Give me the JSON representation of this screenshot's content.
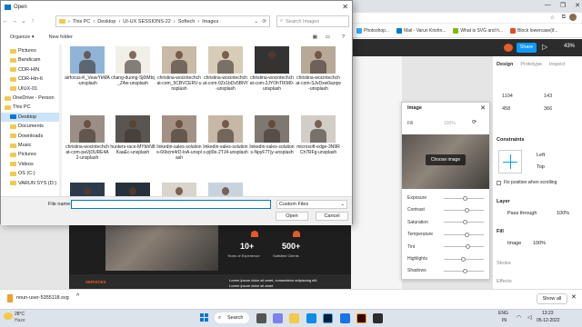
{
  "dialog": {
    "title": "Open",
    "breadcrumb": [
      "This PC",
      "Desktop",
      "UI-UX SESSIONS-22",
      "Softech",
      "Images"
    ],
    "search_placeholder": "Search Images",
    "organize_label": "Organize ▾",
    "new_folder_label": "New folder",
    "file_name_label": "File name:",
    "file_name_value": "",
    "file_type": "Custom Files",
    "open_label": "Open",
    "cancel_label": "Cancel",
    "tree": [
      {
        "label": "Pictures",
        "indent": 1
      },
      {
        "label": "Bandicam",
        "indent": 1
      },
      {
        "label": "CDR-HIN",
        "indent": 1
      },
      {
        "label": "CDR-Hin-6",
        "indent": 1
      },
      {
        "label": "UIUX-01",
        "indent": 1
      },
      {
        "label": "OneDrive - Person",
        "indent": 0
      },
      {
        "label": "This PC",
        "indent": 0
      },
      {
        "label": "Desktop",
        "indent": 1,
        "selected": true
      },
      {
        "label": "Documents",
        "indent": 1
      },
      {
        "label": "Downloads",
        "indent": 1
      },
      {
        "label": "Music",
        "indent": 1
      },
      {
        "label": "Pictures",
        "indent": 1
      },
      {
        "label": "Videos",
        "indent": 1
      },
      {
        "label": "OS (C:)",
        "indent": 1
      },
      {
        "label": "VARUN SYS (D:)",
        "indent": 1
      }
    ],
    "files": [
      {
        "name": "airfocus-K_VeavYkMA-unsplash",
        "color": "#8fb4d8"
      },
      {
        "name": "chang-duong-Sj0iMtq_Z4w-unsplash",
        "color": "#f2efe9"
      },
      {
        "name": "christina-wocintechchat-com_5CBVCERV-unsplash",
        "color": "#c9b9a6"
      },
      {
        "name": "christina-wocintechchat-com-0Zx1bDv5BNY-unsplash",
        "color": "#d8ccb9"
      },
      {
        "name": "christina-wocintechchat-com-2JYOhTIKM0-unsplash",
        "color": "#333333"
      },
      {
        "name": "christina-wocintechchat-com-SJvDxw0azqw-unsplash",
        "color": "#b7a898"
      },
      {
        "name": "christina-wocintechchat-com-paVjDURE4A2-unsplash",
        "color": "#9a8e86"
      },
      {
        "name": "hunters-race-MYbhN8KaaEc-unsplash",
        "color": "#5a5551"
      },
      {
        "name": "linkedin-sales-solutions-66bcm4rD-loA-unsplash",
        "color": "#a39283"
      },
      {
        "name": "linkedin-sales-solutions-pjt0e-2TJ4-unsplash",
        "color": "#c6b7a6"
      },
      {
        "name": "linkedin-sales-solutions-NpyF7Tjy-unsplash",
        "color": "#7e7871"
      },
      {
        "name": "microsoft-edge-3N9RCh7RFg-unsplash",
        "color": "#d2cdc6"
      },
      {
        "name": "",
        "color": "#2d3a4a"
      },
      {
        "name": "",
        "color": "#27313b"
      },
      {
        "name": "",
        "color": "#d9d4cc"
      },
      {
        "name": "",
        "color": "#c8d3de"
      }
    ]
  },
  "browser": {
    "bookmarks": [
      {
        "label": "Photoshop...",
        "color": "#31a8ff"
      },
      {
        "label": "Mail - Varun Krishn...",
        "color": "#0078d4"
      },
      {
        "label": "What is SVG and h...",
        "color": "#7fba00"
      },
      {
        "label": "Block lowercase(if...",
        "color": "#e34c26"
      }
    ],
    "download_file": "noun-user-5355118.svg",
    "show_all": "Show all"
  },
  "figma": {
    "share_label": "Share",
    "zoom": "43%",
    "tabs": [
      "Design",
      "Prototype",
      "Inspect"
    ],
    "x": "1104",
    "y": "143",
    "w": "458",
    "h": "366",
    "constraints_label": "Constraints",
    "left_constraint": "Left",
    "top_constraint": "Top",
    "fix_scroll": "Fix position when scrolling",
    "layer_label": "Layer",
    "pass_through": "Pass through",
    "layer_pct": "100%",
    "fill_label": "Fill",
    "fill_type": "Image",
    "fill_pct": "100%",
    "stroke_label": "Stroke",
    "effects_label": "Effects",
    "image_panel": {
      "title": "Image",
      "fill_mode": "Fill",
      "fill_pct": "100%",
      "choose_image": "Choose image",
      "adjustments": [
        {
          "label": "Exposure",
          "pos": 0.55
        },
        {
          "label": "Contrast",
          "pos": 0.6
        },
        {
          "label": "Saturation",
          "pos": 0.55
        },
        {
          "label": "Temperature",
          "pos": 0.58
        },
        {
          "label": "Tint",
          "pos": 0.62
        },
        {
          "label": "Highlights",
          "pos": 0.5
        },
        {
          "label": "Shadows",
          "pos": 0.55
        }
      ]
    }
  },
  "frame": {
    "stat1_value": "10+",
    "stat1_label": "Years of Experience",
    "stat2_value": "500+",
    "stat2_label": "Satisfied Clients",
    "services": "SERVICES",
    "lorem1": "Lorem ipsum dolor sit amet, consectetur adipiscing elit.",
    "lorem2": "Lorem ipsum dolor sit amet"
  },
  "taskbar": {
    "weather_temp": "28°C",
    "weather_text": "Haze",
    "search_label": "Search",
    "lang": "ENG",
    "region": "IN",
    "time": "13:23",
    "date": "05-12-2022"
  }
}
